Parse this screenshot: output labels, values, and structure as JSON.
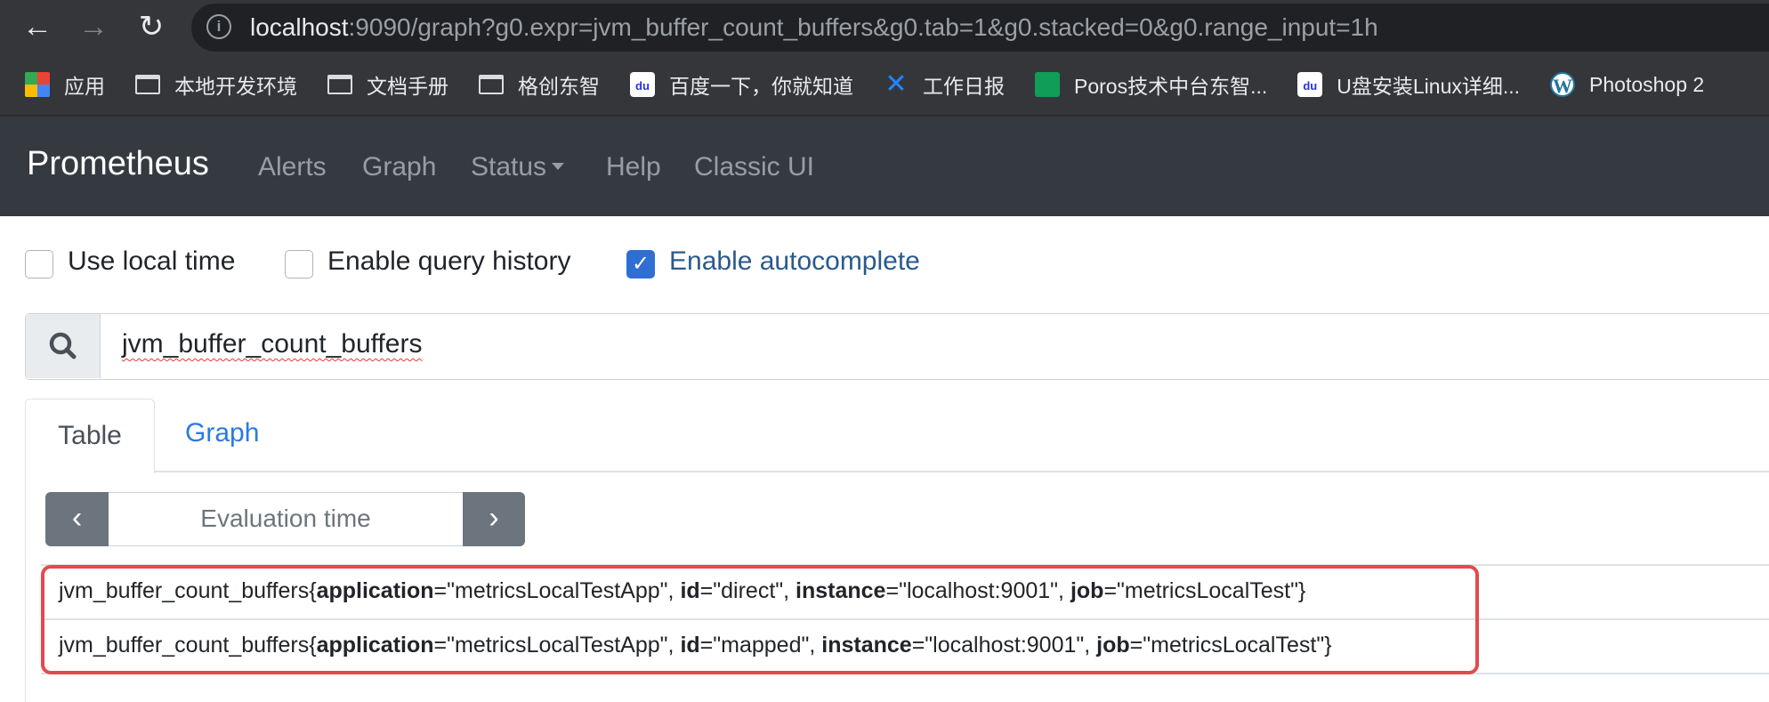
{
  "browser": {
    "url_host": "localhost",
    "url_rest": ":9090/graph?g0.expr=jvm_buffer_count_buffers&g0.tab=1&g0.stacked=0&g0.range_input=1h",
    "bookmarks": [
      {
        "label": "应用",
        "icon": "apps-grid-icon"
      },
      {
        "label": "本地开发环境",
        "icon": "folder-icon"
      },
      {
        "label": "文档手册",
        "icon": "folder-icon"
      },
      {
        "label": "格创东智",
        "icon": "folder-icon"
      },
      {
        "label": "百度一下，你就知道",
        "icon": "baidu-icon"
      },
      {
        "label": "工作日报",
        "icon": "confluence-icon"
      },
      {
        "label": "Poros技术中台东智...",
        "icon": "sheets-icon"
      },
      {
        "label": "U盘安装Linux详细...",
        "icon": "baidu-icon"
      },
      {
        "label": "Photoshop 2",
        "icon": "wordpress-icon"
      }
    ]
  },
  "navbar": {
    "brand": "Prometheus",
    "links": [
      "Alerts",
      "Graph",
      "Status",
      "Help",
      "Classic UI"
    ]
  },
  "options": {
    "use_local_time": {
      "label": "Use local time",
      "checked": false
    },
    "enable_query_history": {
      "label": "Enable query history",
      "checked": false
    },
    "enable_autocomplete": {
      "label": "Enable autocomplete",
      "checked": true
    }
  },
  "query": {
    "expression": "jvm_buffer_count_buffers"
  },
  "tabs": {
    "table": "Table",
    "graph": "Graph",
    "active": "Table"
  },
  "evaluation": {
    "placeholder": "Evaluation time",
    "prev": "‹",
    "next": "›"
  },
  "results": [
    {
      "metric": "jvm_buffer_count_buffers{",
      "labels": [
        {
          "k": "application",
          "v": "=\"metricsLocalTestApp\", "
        },
        {
          "k": "id",
          "v": "=\"direct\", "
        },
        {
          "k": "instance",
          "v": "=\"localhost:9001\", "
        },
        {
          "k": "job",
          "v": "=\"metricsLocalTest\"}"
        }
      ]
    },
    {
      "metric": "jvm_buffer_count_buffers{",
      "labels": [
        {
          "k": "application",
          "v": "=\"metricsLocalTestApp\", "
        },
        {
          "k": "id",
          "v": "=\"mapped\", "
        },
        {
          "k": "instance",
          "v": "=\"localhost:9001\", "
        },
        {
          "k": "job",
          "v": "=\"metricsLocalTest\"}"
        }
      ]
    }
  ],
  "colors": {
    "navbar": "#343a40",
    "highlight": "#e5484d",
    "link": "#2a7ae2",
    "checkbox": "#2f6fd4"
  }
}
